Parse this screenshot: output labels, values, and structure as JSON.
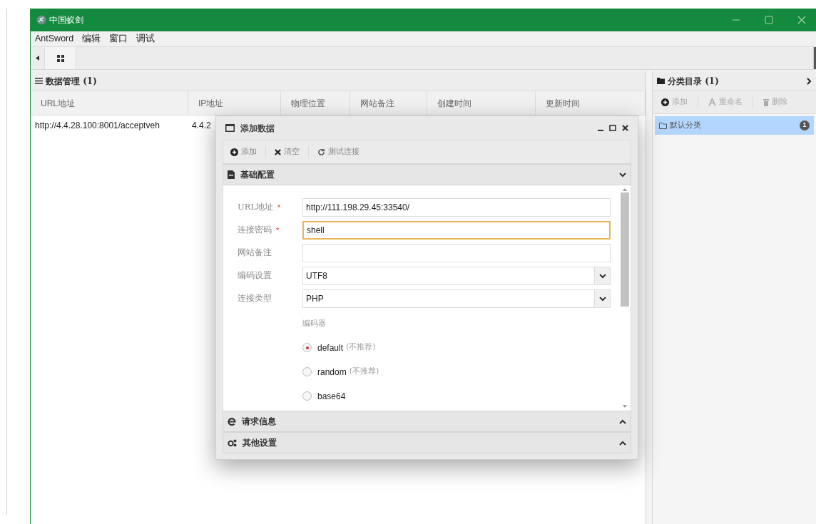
{
  "window": {
    "title": "中国蚁剑"
  },
  "menu": [
    {
      "label": "AntSword"
    },
    {
      "label": "编辑"
    },
    {
      "label": "窗口"
    },
    {
      "label": "调试"
    }
  ],
  "data_panel": {
    "title": "数据管理 (1)",
    "columns": [
      "URL地址",
      "IP地址",
      "物理位置",
      "网站备注",
      "创建时间",
      "更新时间"
    ],
    "rows": [
      {
        "cells": [
          "http://4.4.28.100:8001/acceptveh",
          "4.4.2"
        ]
      }
    ]
  },
  "category_panel": {
    "title": "分类目录 (1)",
    "toolbar": [
      {
        "label": "添加"
      },
      {
        "label": "重命名"
      },
      {
        "label": "删除"
      }
    ],
    "items": [
      {
        "label": "默认分类",
        "count": "1",
        "selected": true
      }
    ]
  },
  "dialog": {
    "title": "添加数据",
    "toolbar": [
      {
        "label": "添加"
      },
      {
        "label": "清空"
      },
      {
        "label": "测试连接"
      }
    ],
    "sections": [
      {
        "title": "基础配置",
        "expanded": true
      },
      {
        "title": "请求信息",
        "expanded": false
      },
      {
        "title": "其他设置",
        "expanded": false
      }
    ],
    "fields": [
      {
        "kind": "text",
        "label": "URL地址",
        "marker": "*",
        "value": "http://111.198.29.45:33540/",
        "focused": false
      },
      {
        "kind": "text",
        "label": "连接密码",
        "marker": "*",
        "value": "shell",
        "focused": true
      },
      {
        "kind": "text",
        "label": "网站备注",
        "focused": false
      },
      {
        "kind": "select",
        "label": "编码设置",
        "value": "UTF8",
        "focused": false
      },
      {
        "kind": "select",
        "label": "连接类型",
        "value": "PHP",
        "focused": false
      }
    ],
    "encoder": {
      "label": "编码器",
      "options": [
        {
          "label": "default",
          "note": "(不推荐)",
          "selected": true
        },
        {
          "label": "random",
          "note": "(不推荐)",
          "selected": false
        },
        {
          "label": "base64",
          "selected": false
        }
      ]
    }
  }
}
